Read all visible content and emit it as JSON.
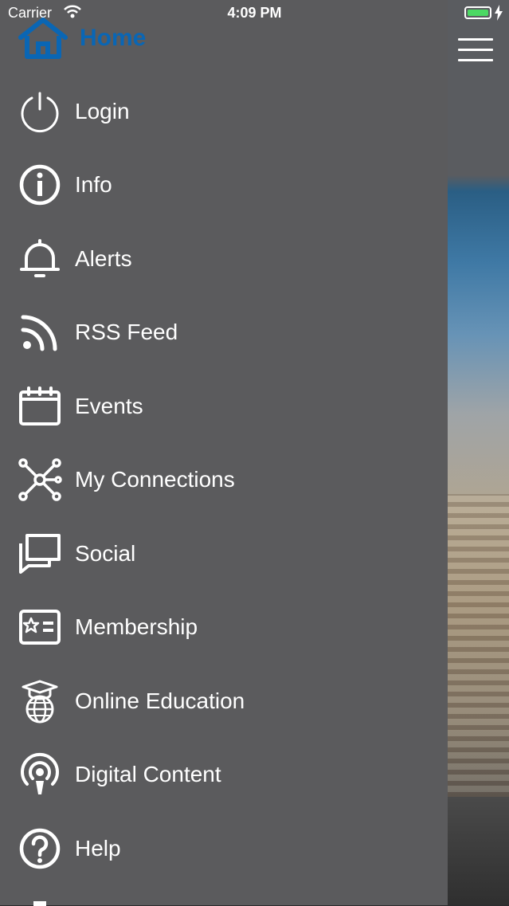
{
  "status_bar": {
    "carrier": "Carrier",
    "time": "4:09 PM"
  },
  "home": {
    "label": "Home",
    "icon": "home-icon",
    "color": "#0a66b4"
  },
  "menu": [
    {
      "label": "Login",
      "icon": "power-icon"
    },
    {
      "label": "Info",
      "icon": "info-icon"
    },
    {
      "label": "Alerts",
      "icon": "bell-icon"
    },
    {
      "label": "RSS Feed",
      "icon": "rss-icon"
    },
    {
      "label": "Events",
      "icon": "calendar-icon"
    },
    {
      "label": "My Connections",
      "icon": "network-icon"
    },
    {
      "label": "Social",
      "icon": "chat-icon"
    },
    {
      "label": "Membership",
      "icon": "member-card-icon"
    },
    {
      "label": "Online Education",
      "icon": "graduation-globe-icon"
    },
    {
      "label": "Digital Content",
      "icon": "podcast-icon"
    },
    {
      "label": "Help",
      "icon": "help-icon"
    }
  ],
  "colors": {
    "drawer_bg": "#5b5b5d",
    "text": "#ffffff",
    "accent": "#0a66b4",
    "battery": "#4cd964"
  }
}
